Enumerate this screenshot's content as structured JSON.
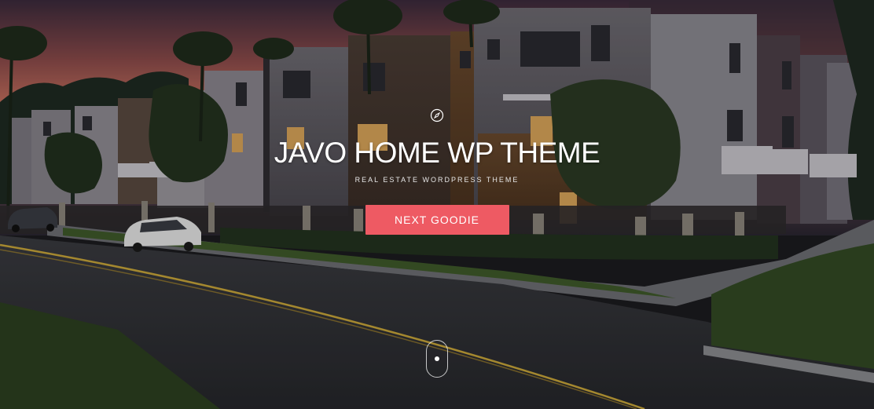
{
  "hero": {
    "title": "JAVO HOME WP THEME",
    "subtitle": "REAL ESTATE WORDPRESS THEME",
    "cta_label": "NEXT GOODIE",
    "icon": "compass-icon",
    "scroll_icon": "mouse-scroll-icon",
    "background": "night-street-townhouses-photo"
  },
  "colors": {
    "accent": "#ee5a63",
    "text": "#ffffff"
  }
}
